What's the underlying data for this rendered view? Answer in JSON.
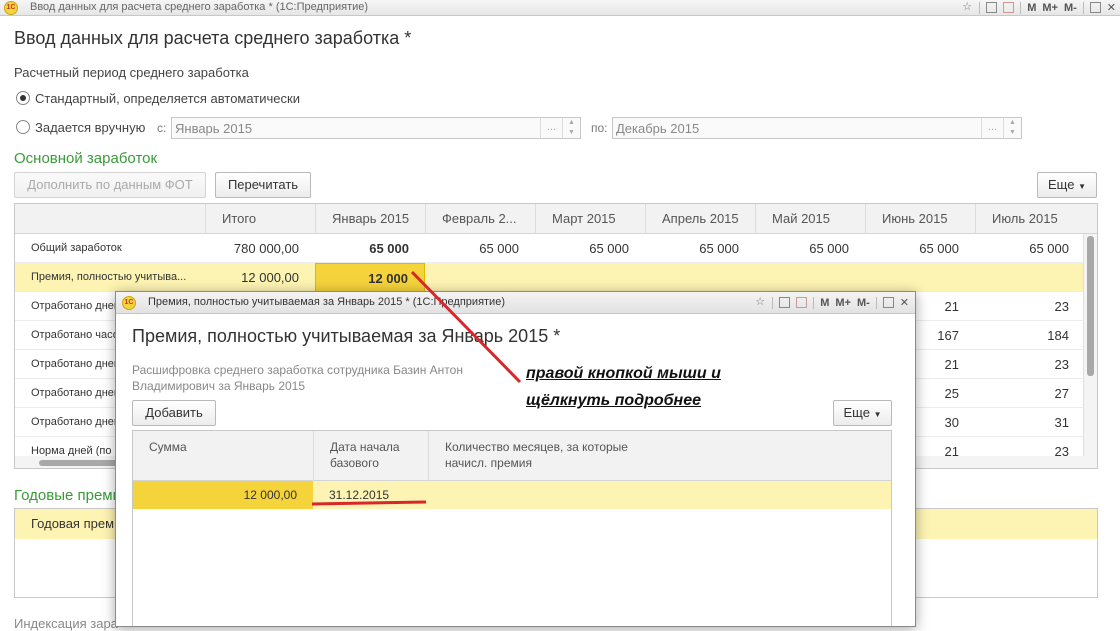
{
  "window": {
    "title": "Ввод данных для расчета среднего заработка * (1С:Предприятие)",
    "logo_text": "1С",
    "buttons": [
      "M",
      "M+",
      "M-"
    ]
  },
  "page_title": "Ввод данных для расчета среднего заработка *",
  "period": {
    "label": "Расчетный период среднего заработка",
    "option_standard": "Стандартный, определяется автоматически",
    "option_manual": "Задается вручную",
    "from_label": "с:",
    "from_value": "Январь 2015",
    "to_label": "по:",
    "to_value": "Декабрь 2015"
  },
  "main_earnings": {
    "title": "Основной заработок",
    "fill_button": "Дополнить по данным ФОТ",
    "recalc_button": "Перечитать",
    "more_button": "Еще"
  },
  "grid": {
    "columns": [
      "",
      "Итого",
      "Январь 2015",
      "Февраль 2...",
      "Март 2015",
      "Апрель 2015",
      "Май 2015",
      "Июнь 2015",
      "Июль 2015"
    ],
    "rows": [
      {
        "name": "Общий заработок",
        "total": "780 000,00",
        "values": [
          "65 000",
          "65 000",
          "65 000",
          "65 000",
          "65 000",
          "65 000",
          "65 000"
        ]
      },
      {
        "name": "Премия, полностью учитыва...",
        "total": "12 000,00",
        "values": [
          "12 000",
          "",
          "",
          "",
          "",
          "",
          ""
        ]
      },
      {
        "name": "Отработано дней",
        "total": "",
        "values": [
          "",
          "",
          "",
          "",
          "",
          "21",
          "23"
        ]
      },
      {
        "name": "Отработано часов",
        "total": "",
        "values": [
          "",
          "",
          "",
          "",
          "",
          "167",
          "184"
        ]
      },
      {
        "name": "Отработано дней",
        "total": "",
        "values": [
          "",
          "",
          "",
          "",
          "",
          "21",
          "23"
        ]
      },
      {
        "name": "Отработано дней",
        "total": "",
        "values": [
          "",
          "",
          "",
          "",
          "",
          "25",
          "27"
        ]
      },
      {
        "name": "Отработано дней",
        "total": "",
        "values": [
          "",
          "",
          "",
          "",
          "",
          "30",
          "31"
        ]
      },
      {
        "name": "Норма дней (по н",
        "total": "",
        "values": [
          "",
          "",
          "",
          "",
          "",
          "21",
          "23"
        ]
      }
    ]
  },
  "annual": {
    "title": "Годовые преми",
    "row": "Годовая прем"
  },
  "indexation_label": "Индексация зара",
  "dialog": {
    "title": "Премия, полностью учитываемая за Январь 2015 * (1С:Предприятие)",
    "heading": "Премия, полностью учитываемая за Январь 2015 *",
    "subtitle": "Расшифровка среднего заработка сотрудника Базин Антон Владимирович за Январь 2015",
    "add_button": "Добавить",
    "more_button": "Еще",
    "columns": [
      "Сумма",
      "Дата начала базового",
      "Количество месяцев, за которые начисл. премия"
    ],
    "row": {
      "sum": "12 000,00",
      "date": "31.12.2015",
      "months": ""
    }
  },
  "annotation": {
    "text": "правой кнопкой мыши и щёлкнуть подробнее",
    "color": "#d9262b"
  },
  "colors": {
    "section_green": "#3a9a3a",
    "selected_row": "#fdf4b3",
    "current_cell": "#f5d33b"
  }
}
